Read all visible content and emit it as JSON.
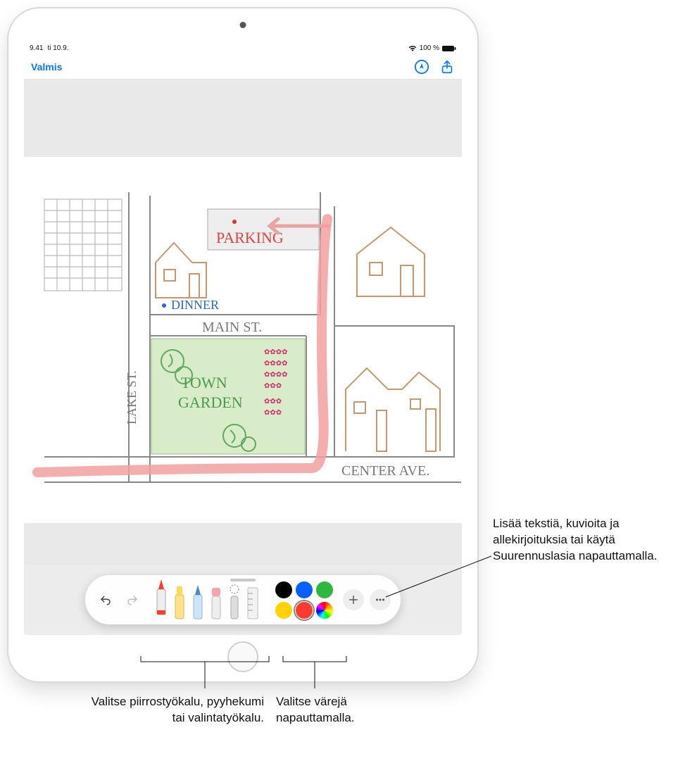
{
  "status": {
    "time": "9.41",
    "date": "ti 10.9.",
    "battery_pct": "100 %"
  },
  "nav": {
    "done_label": "Valmis"
  },
  "canvas": {
    "parking_label": "PARKING",
    "dinner_label": "DINNER",
    "main_st_label": "MAIN ST.",
    "lake_st_label": "LAKE ST.",
    "town_garden_line1": "TOWN",
    "town_garden_line2": "GARDEN",
    "center_ave_label": "CENTER AVE."
  },
  "toolbar": {
    "tools": [
      "pen",
      "marker",
      "pencil",
      "eraser",
      "lasso",
      "ruler"
    ],
    "colors_row1": [
      "#000000",
      "#0a60ff",
      "#2db73c"
    ],
    "colors_row2": [
      "#ffd200",
      "#ff3b30",
      "wheel"
    ],
    "selected_color": "#ff3b30"
  },
  "callouts": {
    "right": "Lisää tekstiä, kuvioita ja allekirjoituksia tai käytä Suurennuslasia napauttamalla.",
    "bottom_left": "Valitse piirrostyökalu, pyyhekumi tai valintatyökalu.",
    "bottom_mid": "Valitse värejä napauttamalla."
  }
}
